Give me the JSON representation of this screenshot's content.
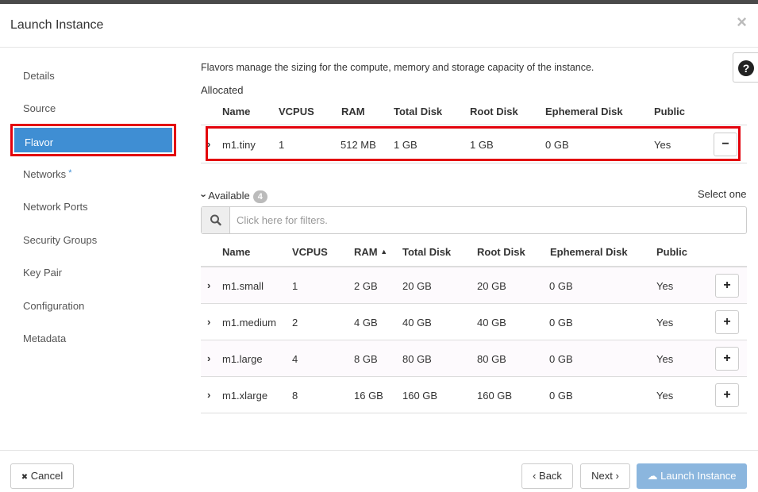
{
  "modal": {
    "title": "Launch Instance",
    "close_glyph": "×"
  },
  "sidebar": {
    "items": [
      {
        "label": "Details"
      },
      {
        "label": "Source"
      },
      {
        "label": "Flavor",
        "active": true
      },
      {
        "label": "Networks",
        "required_mark": "*"
      },
      {
        "label": "Network Ports"
      },
      {
        "label": "Security Groups"
      },
      {
        "label": "Key Pair"
      },
      {
        "label": "Configuration"
      },
      {
        "label": "Metadata"
      }
    ]
  },
  "help": {
    "glyph": "?",
    "icon": "question-circle-icon"
  },
  "flavor": {
    "description": "Flavors manage the sizing for the compute, memory and storage capacity of the instance.",
    "allocated_label": "Allocated",
    "allocated_columns": [
      "Name",
      "VCPUS",
      "RAM",
      "Total Disk",
      "Root Disk",
      "Ephemeral Disk",
      "Public"
    ],
    "allocated_rows": [
      {
        "name": "m1.tiny",
        "vcpus": "1",
        "ram": "512 MB",
        "total_disk": "1 GB",
        "root_disk": "1 GB",
        "ephemeral_disk": "0 GB",
        "public": "Yes",
        "action": "−"
      }
    ],
    "available_label": "Available",
    "available_count": "4",
    "select_hint": "Select one",
    "filter_placeholder": "Click here for filters.",
    "available_columns": [
      "Name",
      "VCPUS",
      "RAM",
      "Total Disk",
      "Root Disk",
      "Ephemeral Disk",
      "Public"
    ],
    "sort_indicator": "▲",
    "available_rows": [
      {
        "name": "m1.small",
        "vcpus": "1",
        "ram": "2 GB",
        "total_disk": "20 GB",
        "root_disk": "20 GB",
        "ephemeral_disk": "0 GB",
        "public": "Yes",
        "action": "+"
      },
      {
        "name": "m1.medium",
        "vcpus": "2",
        "ram": "4 GB",
        "total_disk": "40 GB",
        "root_disk": "40 GB",
        "ephemeral_disk": "0 GB",
        "public": "Yes",
        "action": "+"
      },
      {
        "name": "m1.large",
        "vcpus": "4",
        "ram": "8 GB",
        "total_disk": "80 GB",
        "root_disk": "80 GB",
        "ephemeral_disk": "0 GB",
        "public": "Yes",
        "action": "+"
      },
      {
        "name": "m1.xlarge",
        "vcpus": "8",
        "ram": "16 GB",
        "total_disk": "160 GB",
        "root_disk": "160 GB",
        "ephemeral_disk": "0 GB",
        "public": "Yes",
        "action": "+"
      }
    ]
  },
  "footer": {
    "cancel_label": "Cancel",
    "cancel_glyph": "✖",
    "back_label": "Back",
    "back_glyph": "‹",
    "next_label": "Next",
    "next_glyph": "›",
    "launch_label": "Launch Instance",
    "launch_glyph": "☁"
  },
  "colors": {
    "accent": "#3f8ed3",
    "highlight_border": "#e3000b",
    "launch_disabled": "#8bb6de"
  }
}
